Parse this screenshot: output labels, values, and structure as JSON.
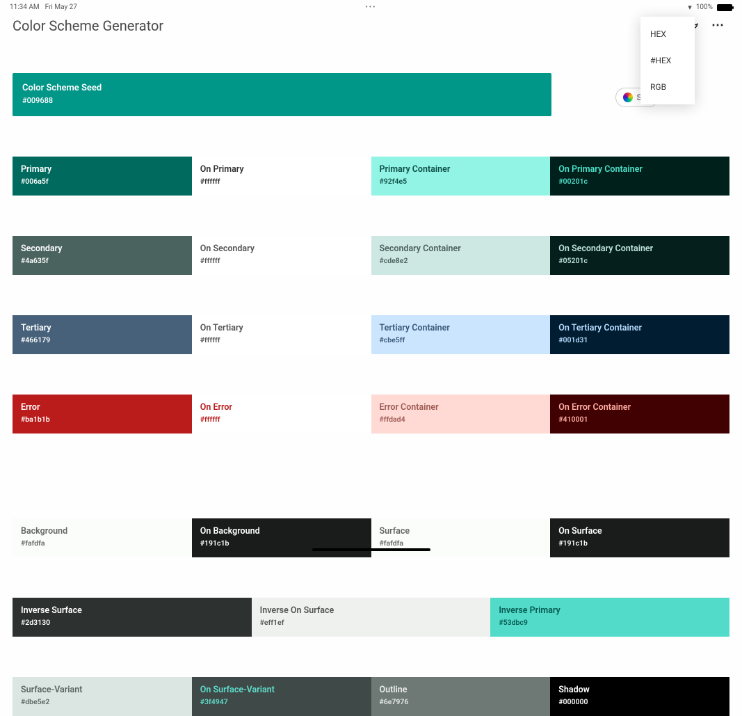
{
  "status": {
    "time": "11:34 AM",
    "date": "Fri May 27",
    "center": "•••",
    "battery": "100%"
  },
  "title": "Color Scheme Generator",
  "format_menu": {
    "opt0": "HEX",
    "opt1": "#HEX",
    "opt2": "RGB"
  },
  "select_chip": "Sel",
  "seed": {
    "label": "Color Scheme Seed",
    "hex": "#009688"
  },
  "row0": {
    "c0": {
      "name": "Primary",
      "hex": "#006a5f",
      "bg": "#006a5f",
      "fg": "#ffffff"
    },
    "c1": {
      "name": "On Primary",
      "hex": "#ffffff",
      "bg": "#ffffff",
      "fg": "#333333"
    },
    "c2": {
      "name": "Primary Container",
      "hex": "#92f4e5",
      "bg": "#92f4e5",
      "fg": "#0e4f47"
    },
    "c3": {
      "name": "On Primary Container",
      "hex": "#00201c",
      "bg": "#00201c",
      "fg": "#4de0c8"
    }
  },
  "row1": {
    "c0": {
      "name": "Secondary",
      "hex": "#4a635f",
      "bg": "#4a635f",
      "fg": "#ffffff"
    },
    "c1": {
      "name": "On Secondary",
      "hex": "#ffffff",
      "bg": "#ffffff",
      "fg": "#555555"
    },
    "c2": {
      "name": "Secondary Container",
      "hex": "#cde8e2",
      "bg": "#cde8e2",
      "fg": "#4c615d"
    },
    "c3": {
      "name": "On Secondary Container",
      "hex": "#05201c",
      "bg": "#05201c",
      "fg": "#bfe2db"
    }
  },
  "row2": {
    "c0": {
      "name": "Tertiary",
      "hex": "#466179",
      "bg": "#466179",
      "fg": "#ffffff"
    },
    "c1": {
      "name": "On Tertiary",
      "hex": "#ffffff",
      "bg": "#ffffff",
      "fg": "#555555"
    },
    "c2": {
      "name": "Tertiary Container",
      "hex": "#cbe5ff",
      "bg": "#cbe5ff",
      "fg": "#3a5876"
    },
    "c3": {
      "name": "On Tertiary Container",
      "hex": "#001d31",
      "bg": "#001d31",
      "fg": "#b8dbff"
    }
  },
  "row3": {
    "c0": {
      "name": "Error",
      "hex": "#ba1b1b",
      "bg": "#ba1b1b",
      "fg": "#ffffff"
    },
    "c1": {
      "name": "On Error",
      "hex": "#ffffff",
      "bg": "#ffffff",
      "fg": "#ba1b1b"
    },
    "c2": {
      "name": "Error Container",
      "hex": "#ffdad4",
      "bg": "#ffdad4",
      "fg": "#9c5a52"
    },
    "c3": {
      "name": "On Error Container",
      "hex": "#410001",
      "bg": "#410001",
      "fg": "#ffaea5"
    }
  },
  "row4": {
    "c0": {
      "name": "Background",
      "hex": "#fafdfa",
      "bg": "#fafdfa",
      "fg": "#666666"
    },
    "c1": {
      "name": "On Background",
      "hex": "#191c1b",
      "bg": "#191c1b",
      "fg": "#ffffff"
    },
    "c2": {
      "name": "Surface",
      "hex": "#fafdfa",
      "bg": "#fafdfa",
      "fg": "#666666"
    },
    "c3": {
      "name": "On Surface",
      "hex": "#191c1b",
      "bg": "#191c1b",
      "fg": "#ffffff"
    }
  },
  "row5": {
    "c0": {
      "name": "Inverse Surface",
      "hex": "#2d3130",
      "bg": "#2d3130",
      "fg": "#ffffff"
    },
    "c1": {
      "name": "Inverse On Surface",
      "hex": "#eff1ef",
      "bg": "#eff1ef",
      "fg": "#555555"
    },
    "c2": {
      "name": "Inverse Primary",
      "hex": "#53dbc9",
      "bg": "#53dbc9",
      "fg": "#065b51"
    }
  },
  "row6": {
    "c0": {
      "name": "Surface-Variant",
      "hex": "#dbe5e2",
      "bg": "#dbe5e2",
      "fg": "#5b6764"
    },
    "c1": {
      "name": "On Surface-Variant",
      "hex": "#3f4947",
      "bg": "#3f4947",
      "fg": "#5fdccb"
    },
    "c2": {
      "name": "Outline",
      "hex": "#6e7976",
      "bg": "#6e7976",
      "fg": "#e9eceb"
    },
    "c3": {
      "name": "Shadow",
      "hex": "#000000",
      "bg": "#000000",
      "fg": "#ffffff"
    }
  }
}
